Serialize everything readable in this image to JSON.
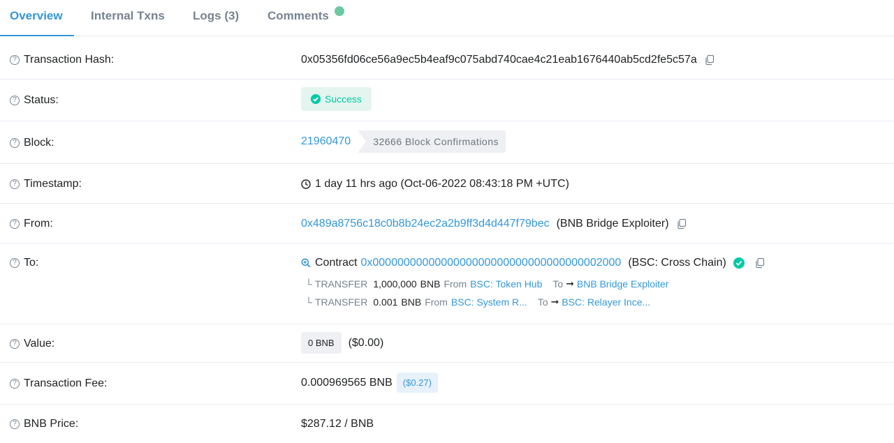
{
  "tabs": {
    "overview": "Overview",
    "internal": "Internal Txns",
    "logs": "Logs (3)",
    "comments": "Comments"
  },
  "rows": {
    "hash": {
      "label": "Transaction Hash:",
      "value": "0x05356fd06ce56a9ec5b4eaf9c075abd740cae4c21eab1676440ab5cd2fe5c57a"
    },
    "status": {
      "label": "Status:",
      "value": "Success"
    },
    "block": {
      "label": "Block:",
      "number": "21960470",
      "confirmations": "32666 Block Confirmations"
    },
    "timestamp": {
      "label": "Timestamp:",
      "value": "1 day 11 hrs ago (Oct-06-2022 08:43:18 PM +UTC)"
    },
    "from": {
      "label": "From:",
      "address": "0x489a8756c18c0b8b24ec2a2b9ff3d4d447f79bec",
      "name": "(BNB Bridge Exploiter)"
    },
    "to": {
      "label": "To:",
      "prefix": "Contract",
      "address": "0x0000000000000000000000000000000000002000",
      "name": "(BSC: Cross Chain)",
      "transfers": [
        {
          "tag": "TRANSFER",
          "amount": "1,000,000",
          "token": "BNB",
          "from_label": "From",
          "from": "BSC: Token Hub",
          "to_label": "To",
          "to": "BNB Bridge Exploiter"
        },
        {
          "tag": "TRANSFER",
          "amount": "0.001",
          "token": "BNB",
          "from_label": "From",
          "from": "BSC: System R...",
          "to_label": "To",
          "to": "BSC: Relayer Ince..."
        }
      ]
    },
    "value": {
      "label": "Value:",
      "amount": "0 BNB",
      "usd": "($0.00)"
    },
    "fee": {
      "label": "Transaction Fee:",
      "amount": "0.000969565 BNB",
      "usd": "($0.27)"
    },
    "price": {
      "label": "BNB Price:",
      "value": "$287.12 / BNB"
    }
  },
  "colors": {
    "accent": "#3498db",
    "success": "#00c9a7",
    "comment_dot": "#6cc9a0"
  }
}
